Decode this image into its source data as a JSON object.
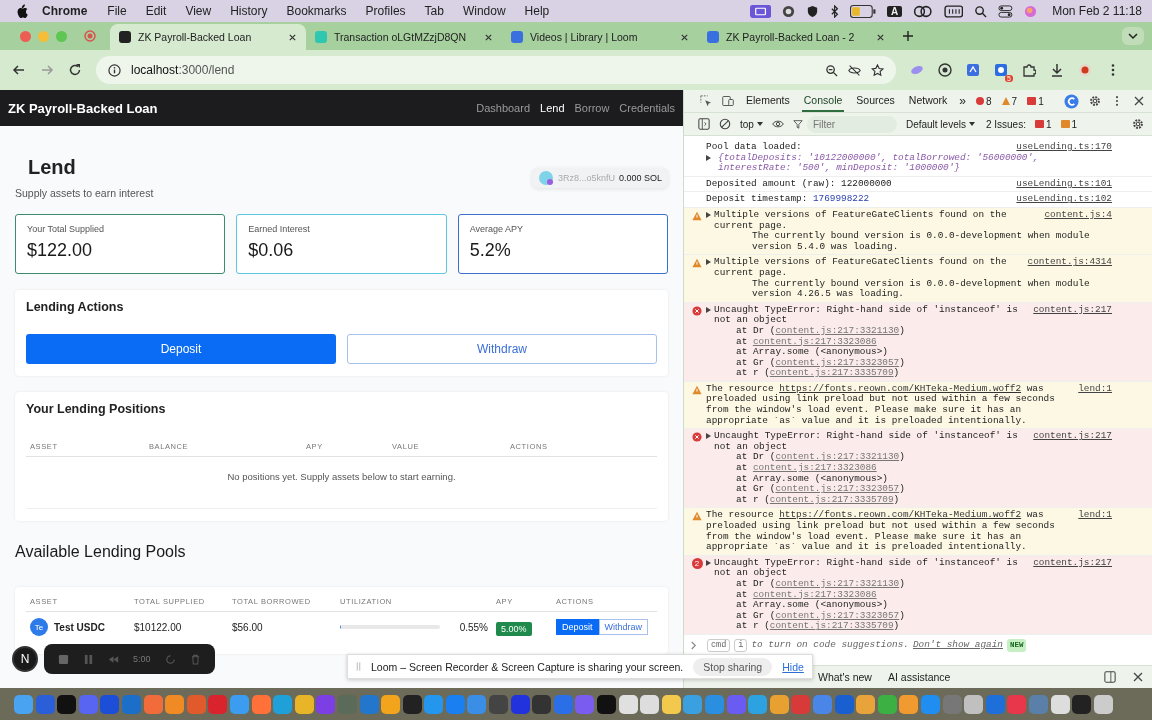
{
  "menubar": {
    "app": "Chrome",
    "menus": [
      "File",
      "Edit",
      "View",
      "History",
      "Bookmarks",
      "Profiles",
      "Tab",
      "Window",
      "Help"
    ],
    "input_source": "A",
    "clock": "Mon Feb 2  11:18"
  },
  "browser": {
    "tabs": [
      {
        "title": "ZK Payroll-Backed Loan",
        "selected": true,
        "color": "#222222"
      },
      {
        "title": "Transaction oLGtMZzjD8QN",
        "selected": false,
        "color": "#2fc7b0"
      },
      {
        "title": "Videos | Library | Loom",
        "selected": false,
        "color": "#3a6fe0"
      },
      {
        "title": "ZK Payroll-Backed Loan - 2",
        "selected": false,
        "color": "#3a6fe0"
      }
    ],
    "url_host": "localhost",
    "url_path": ":3000/lend",
    "extension_badge": "5"
  },
  "app": {
    "brand": "ZK Payroll-Backed Loan",
    "nav": [
      {
        "label": "Dashboard",
        "selected": false
      },
      {
        "label": "Lend",
        "selected": true
      },
      {
        "label": "Borrow",
        "selected": false
      },
      {
        "label": "Credentials",
        "selected": false
      }
    ],
    "title": "Lend",
    "subtitle": "Supply assets to earn interest",
    "wallet": {
      "address": "3Rz8...o5knfU",
      "balance": "0.000 SOL"
    },
    "stats": [
      {
        "label": "Your Total Supplied",
        "value": "$122.00",
        "color": "#3d8a6e"
      },
      {
        "label": "Earned Interest",
        "value": "$0.06",
        "color": "#5bc8e0"
      },
      {
        "label": "Average APY",
        "value": "5.2%",
        "color": "#3b6fd1"
      }
    ],
    "actions": {
      "title": "Lending Actions",
      "buttons": [
        {
          "label": "Deposit",
          "kind": "primary"
        },
        {
          "label": "Withdraw",
          "kind": "outline"
        }
      ]
    },
    "positions": {
      "title": "Your Lending Positions",
      "columns": [
        "ASSET",
        "BALANCE",
        "APY",
        "VALUE",
        "ACTIONS"
      ],
      "empty": "No positions yet. Supply assets below to start earning."
    },
    "pools": {
      "title": "Available Lending Pools",
      "columns": [
        "ASSET",
        "TOTAL SUPPLIED",
        "TOTAL BORROWED",
        "UTILIZATION",
        "APY",
        "ACTIONS"
      ],
      "rows": [
        {
          "badge": "Te",
          "asset": "Test USDC",
          "supplied": "$10122.00",
          "borrowed": "$56.00",
          "level": 0.0055,
          "utilization": "0.55%",
          "apy": "5.00%",
          "actions": [
            {
              "label": "Deposit",
              "kind": "primary"
            },
            {
              "label": "Withdraw",
              "kind": "outline"
            }
          ]
        }
      ]
    }
  },
  "devtools": {
    "tabs": [
      {
        "label": "Elements",
        "selected": false
      },
      {
        "label": "Console",
        "selected": true
      },
      {
        "label": "Sources",
        "selected": false
      },
      {
        "label": "Network",
        "selected": false
      }
    ],
    "more": "»",
    "errors": "8",
    "warnings": "7",
    "issues": "1",
    "context": "top",
    "filter_placeholder": "Filter",
    "levels": "Default levels",
    "issues_label": "2 Issues:",
    "issue_counts": [
      "1",
      "1"
    ],
    "messages": [
      {
        "kind": "log",
        "text": "Pool data loaded:",
        "source": "useLending.ts:170",
        "object": "{totalDeposits: '10122000000', totalBorrowed: '56000000', interestRate: '500', minDeposit: '1000000'}"
      },
      {
        "kind": "log",
        "text": "Deposited amount (raw): 122000000",
        "source": "useLending.ts:101"
      },
      {
        "kind": "log",
        "text": "Deposit timestamp: ",
        "number": "1769998222",
        "source": "useLending.ts:102"
      },
      {
        "kind": "warning",
        "text": "Multiple versions of FeatureGateClients found on the current page.",
        "detail": "The currently bound version is 0.0.0-development when module version 5.4.0 was loading.",
        "source": "content.js:4"
      },
      {
        "kind": "warning",
        "text": "Multiple versions of FeatureGateClients found on the current page.",
        "detail": "The currently bound version is 0.0.0-development when module version 4.26.5 was loading.",
        "source": "content.js:4314"
      },
      {
        "kind": "error",
        "text": "Uncaught TypeError: Right-hand side of 'instanceof' is not an object",
        "source": "content.js:217",
        "stack": [
          {
            "pre": "at Dr (",
            "link": "content.js:217:3321130",
            "post": ")"
          },
          {
            "pre": "at ",
            "link": "content.js:217:3323086"
          },
          {
            "pre": "at Array.some (<anonymous>)"
          },
          {
            "pre": "at Gr (",
            "link": "content.js:217:3323057",
            "post": ")"
          },
          {
            "pre": "at r (",
            "link": "content.js:217:3335709",
            "post": ")"
          }
        ]
      },
      {
        "kind": "resource",
        "before": "The resource ",
        "url": "https://fonts.reown.com/KHTeka-Medium.woff2",
        "after": " was preloaded using link preload but not used within a few seconds from the window's load event. Please make sure it has an appropriate `as` value and it is preloaded intentionally.",
        "source": "lend:1"
      },
      {
        "kind": "error",
        "text": "Uncaught TypeError: Right-hand side of 'instanceof' is not an object",
        "source": "content.js:217",
        "stack": [
          {
            "pre": "at Dr (",
            "link": "content.js:217:3321130",
            "post": ")"
          },
          {
            "pre": "at ",
            "link": "content.js:217:3323086"
          },
          {
            "pre": "at Array.some (<anonymous>)"
          },
          {
            "pre": "at Gr (",
            "link": "content.js:217:3323057",
            "post": ")"
          },
          {
            "pre": "at r (",
            "link": "content.js:217:3335709",
            "post": ")"
          }
        ]
      },
      {
        "kind": "resource",
        "before": "The resource ",
        "url": "https://fonts.reown.com/KHTeka-Medium.woff2",
        "after": " was preloaded using link preload but not used within a few seconds from the window's load event. Please make sure it has an appropriate `as` value and it is preloaded intentionally.",
        "source": "lend:1"
      },
      {
        "kind": "error",
        "count": "2",
        "text": "Uncaught TypeError: Right-hand side of 'instanceof' is not an object",
        "source": "content.js:217",
        "stack": [
          {
            "pre": "at Dr (",
            "link": "content.js:217:3321130",
            "post": ")"
          },
          {
            "pre": "at ",
            "link": "content.js:217:3323086"
          },
          {
            "pre": "at Array.some (<anonymous>)"
          },
          {
            "pre": "at Gr (",
            "link": "content.js:217:3323057",
            "post": ")"
          },
          {
            "pre": "at r (",
            "link": "content.js:217:3335709",
            "post": ")"
          }
        ]
      }
    ],
    "prompt": {
      "keys": [
        "cmd",
        "i"
      ],
      "text": "to turn on code suggestions.",
      "link": "Don't show again",
      "badge": "NEW"
    },
    "drawer_tabs": [
      "What's new",
      "AI assistance"
    ]
  },
  "recorder": {
    "avatar": "N",
    "time": "5:00"
  },
  "share_bar": {
    "message": "Loom – Screen Recorder & Screen Capture is sharing your screen.",
    "stop": "Stop sharing",
    "hide": "Hide"
  },
  "dock": [
    {
      "color": "#4aa3f0"
    },
    {
      "color": "#2b5fd9"
    },
    {
      "color": "#111111"
    },
    {
      "color": "#5865f2"
    },
    {
      "color": "#1d4ed8"
    },
    {
      "color": "#1c6fc8"
    },
    {
      "color": "#f26b3a"
    },
    {
      "color": "#f08a24"
    },
    {
      "color": "#e05a2b"
    },
    {
      "color": "#d9232d"
    },
    {
      "color": "#3b9cf0"
    },
    {
      "color": "#ff7139"
    },
    {
      "color": "#1fa0d8"
    },
    {
      "color": "#e8b528"
    },
    {
      "color": "#7b3fe4"
    },
    {
      "color": "#5a6b5a"
    },
    {
      "color": "#2277cc"
    },
    {
      "color": "#f2a41c"
    },
    {
      "color": "#222222"
    },
    {
      "color": "#2496ed"
    },
    {
      "color": "#1a7ff0"
    },
    {
      "color": "#3a8ee6"
    },
    {
      "color": "#444444"
    },
    {
      "color": "#2233dd"
    },
    {
      "color": "#333333"
    },
    {
      "color": "#2a6fe8"
    },
    {
      "color": "#7a5cf0"
    },
    {
      "color": "#111111"
    },
    {
      "color": "#e0e0e0"
    },
    {
      "color": "#dddddd"
    },
    {
      "color": "#f2c94c"
    },
    {
      "color": "#3aa0e0"
    },
    {
      "color": "#2a8fe0"
    },
    {
      "color": "#6a5cf2"
    },
    {
      "color": "#2ca3e0"
    },
    {
      "color": "#e8a030"
    },
    {
      "color": "#d83a3a"
    },
    {
      "color": "#4a86e8"
    },
    {
      "color": "#1a5fd0"
    },
    {
      "color": "#e8a33a"
    },
    {
      "color": "#3cb043"
    },
    {
      "color": "#f09a30"
    },
    {
      "color": "#1f8ef0"
    },
    {
      "color": "#777777"
    },
    {
      "color": "#c0c0c0"
    },
    {
      "color": "#1e6fd9"
    },
    {
      "color": "#e8364a"
    },
    {
      "color": "#5a7fa8"
    },
    {
      "color": "#dddddd"
    },
    {
      "color": "#222222"
    },
    {
      "color": "#cccccc"
    }
  ]
}
